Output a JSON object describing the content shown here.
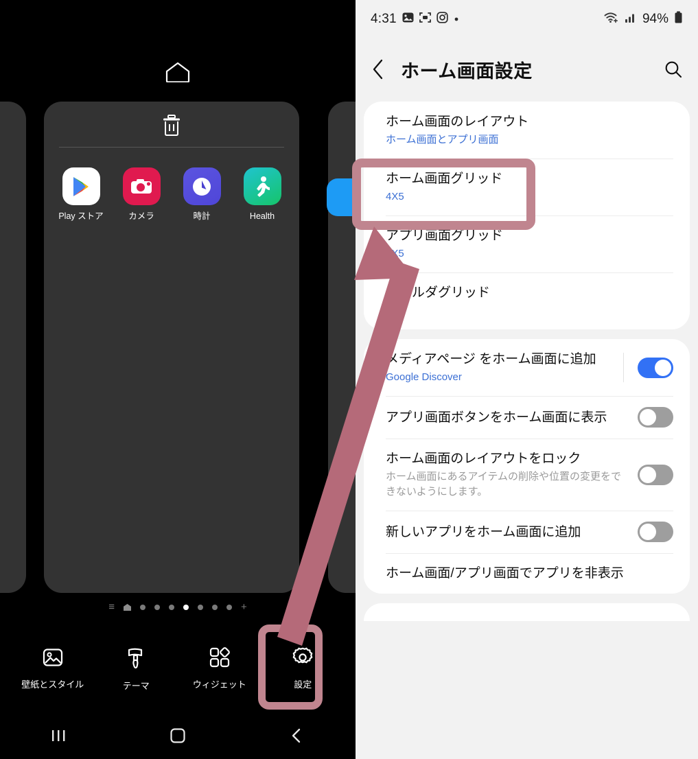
{
  "accent": {
    "highlight_box": "#c0858f",
    "arrow": "#b56a79",
    "link_blue": "#3b6fd4",
    "toggle_on": "#3271f5",
    "toggle_off": "#9e9e9e"
  },
  "home_editor": {
    "home_hint_icon": "home-outline-icon",
    "trash_icon": "trash-icon",
    "apps": [
      {
        "label": "Play ストア",
        "icon": "play-store-icon"
      },
      {
        "label": "カメラ",
        "icon": "camera-icon"
      },
      {
        "label": "時計",
        "icon": "clock-icon"
      },
      {
        "label": "Health",
        "icon": "samsung-health-icon"
      }
    ],
    "page_indicator": {
      "leading_glyph": "≡",
      "home_page_icon": "home-page-icon",
      "dots_before_active": 3,
      "dots_after_active": 3,
      "active_index": 4,
      "trailing_glyph": "+"
    },
    "toolbar": [
      {
        "label": "壁紙とスタイル",
        "icon": "wallpaper-icon",
        "highlighted": false
      },
      {
        "label": "テーマ",
        "icon": "theme-brush-icon",
        "highlighted": false
      },
      {
        "label": "ウィジェット",
        "icon": "widgets-icon",
        "highlighted": false
      },
      {
        "label": "設定",
        "icon": "gear-icon",
        "highlighted": true
      }
    ],
    "nav_bar": {
      "recents": "recents-icon",
      "home": "home-icon",
      "back": "back-icon"
    }
  },
  "settings": {
    "status_bar": {
      "time": "4:31",
      "left_icons": [
        "photo-icon",
        "scan-icon",
        "instagram-icon",
        "dot-icon"
      ],
      "right_icons": [
        "wifi-icon",
        "signal-icon"
      ],
      "battery": "94%",
      "battery_icon": "battery-icon"
    },
    "app_bar": {
      "back_icon": "back-chevron-icon",
      "title": "ホーム画面設定",
      "search_icon": "search-icon"
    },
    "cards": [
      {
        "rows": [
          {
            "title": "ホーム画面のレイアウト",
            "sub": "ホーム画面とアプリ画面",
            "sub_style": "link",
            "control": "none"
          },
          {
            "title": "ホーム画面グリッド",
            "sub": "4X5",
            "sub_style": "link",
            "control": "none",
            "highlighted": true
          },
          {
            "title": "アプリ画面グリッド",
            "sub": "4X5",
            "sub_style": "link",
            "control": "none"
          },
          {
            "title": "フォルダグリッド",
            "sub": "3X4",
            "sub_style": "link",
            "control": "none"
          }
        ]
      },
      {
        "rows": [
          {
            "title": "メディアページ をホーム画面に追加",
            "sub": "Google Discover",
            "sub_style": "link",
            "control": "toggle",
            "toggle_state": "on"
          },
          {
            "title": "アプリ画面ボタンをホーム画面に表示",
            "sub": "",
            "sub_style": "none",
            "control": "toggle",
            "toggle_state": "off"
          },
          {
            "title": "ホーム画面のレイアウトをロック",
            "sub": "ホーム画面にあるアイテムの削除や位置の変更をできないようにします。",
            "sub_style": "muted",
            "control": "toggle",
            "toggle_state": "off"
          },
          {
            "title": "新しいアプリをホーム画面に追加",
            "sub": "",
            "sub_style": "none",
            "control": "toggle",
            "toggle_state": "off"
          },
          {
            "title": "ホーム画面/アプリ画面でアプリを非表示",
            "sub": "",
            "sub_style": "none",
            "control": "none"
          }
        ]
      }
    ],
    "nav_bar": {
      "recents": "recents-icon",
      "home": "home-icon",
      "back": "back-icon"
    }
  }
}
